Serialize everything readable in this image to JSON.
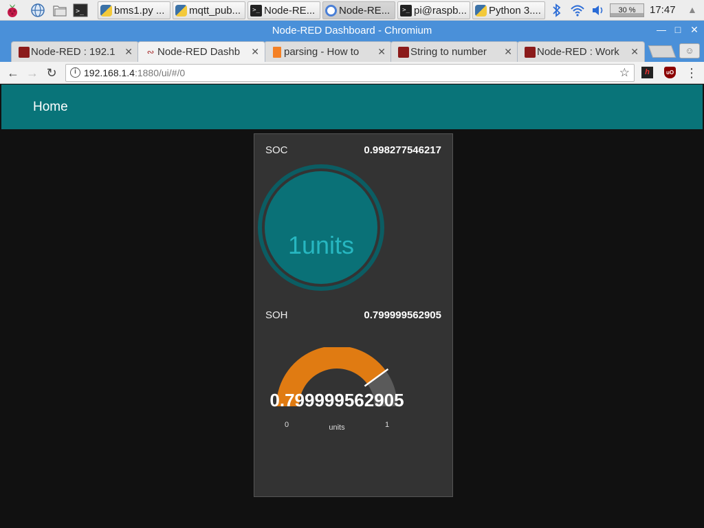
{
  "taskbar": {
    "tasks": [
      {
        "label": "bms1.py ...",
        "icon": "python-icon"
      },
      {
        "label": "mqtt_pub...",
        "icon": "python-icon"
      },
      {
        "label": "Node-RE...",
        "icon": "terminal-icon"
      },
      {
        "label": "Node-RE...",
        "icon": "chromium-icon"
      },
      {
        "label": "pi@raspb...",
        "icon": "terminal-icon"
      },
      {
        "label": "Python 3....",
        "icon": "python-icon"
      }
    ],
    "cpu": "30 %",
    "cpu_fraction": 0.3,
    "clock": "17:47"
  },
  "window": {
    "title": "Node-RED Dashboard - Chromium"
  },
  "tabs": [
    {
      "title": "Node-RED : 192.1",
      "active": false,
      "icon": "node-red-icon"
    },
    {
      "title": "Node-RED Dashb",
      "active": true,
      "icon": "node-red-dashboard-icon"
    },
    {
      "title": "parsing - How to",
      "active": false,
      "icon": "stackoverflow-icon"
    },
    {
      "title": "String to number",
      "active": false,
      "icon": "node-red-icon"
    },
    {
      "title": "Node-RED : Work",
      "active": false,
      "icon": "node-red-icon"
    }
  ],
  "address": {
    "host": "192.168.1.4",
    "path": ":1880/ui/#/0"
  },
  "dashboard": {
    "title": "Home",
    "header_color": "#097479",
    "soc": {
      "label": "SOC",
      "value": "0.998277546217",
      "donut_text": "1units",
      "fraction": 0.998
    },
    "soh": {
      "label": "SOH",
      "value": "0.799999562905",
      "gauge_value": "0.799999562905",
      "units": "units",
      "min": "0",
      "max": "1",
      "fraction": 0.8,
      "color": "#e07b12"
    }
  }
}
